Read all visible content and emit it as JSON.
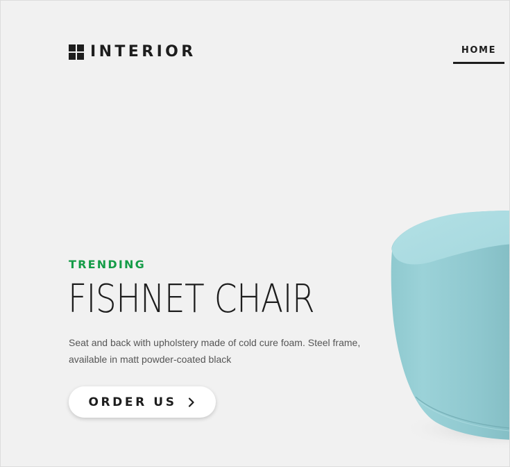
{
  "header": {
    "logo_text": "INTERIOR",
    "nav": {
      "home_label": "HOME"
    }
  },
  "hero": {
    "eyebrow": "TRENDING",
    "title": "FISHNET CHAIR",
    "description": "Seat and back with upholstery made of cold cure foam. Steel frame, available in matt powder-coated black",
    "cta_label": "ORDER US",
    "cta_icon": "chevron-right-icon"
  },
  "product_image": {
    "subject": "pouf"
  },
  "colors": {
    "background": "#f1f1f1",
    "text_dark": "#1d1d1d",
    "accent_green": "#149c47",
    "body_text": "#555555",
    "pouf_fabric": "#9fd3d9"
  }
}
